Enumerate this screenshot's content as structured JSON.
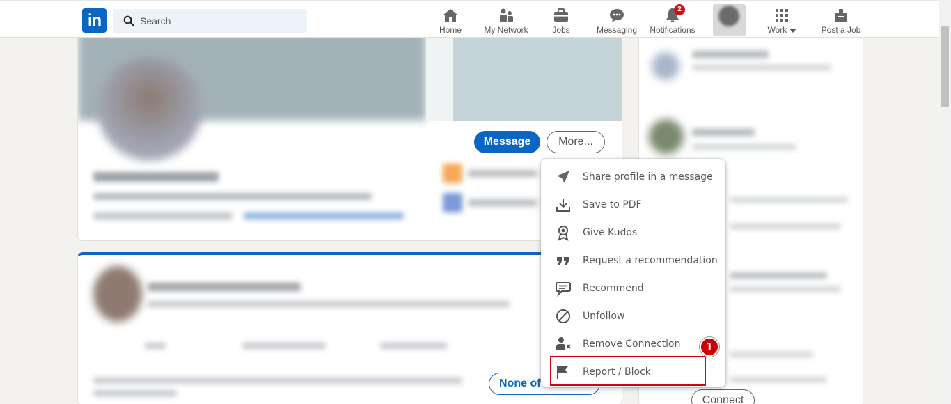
{
  "nav": {
    "search_placeholder": "Search",
    "items": [
      {
        "label": "Home",
        "icon": "home-icon"
      },
      {
        "label": "My Network",
        "icon": "network-icon"
      },
      {
        "label": "Jobs",
        "icon": "briefcase-icon"
      },
      {
        "label": "Messaging",
        "icon": "messaging-icon"
      },
      {
        "label": "Notifications",
        "icon": "bell-icon",
        "badge": "2"
      },
      {
        "label": "Work",
        "icon": "grid-icon"
      },
      {
        "label": "Post a Job",
        "icon": "post-job-icon"
      }
    ]
  },
  "profile": {
    "message_label": "Message",
    "more_label": "More..."
  },
  "activity": {
    "follow_label": "None of"
  },
  "sidebar": {
    "connect_label": "Connect"
  },
  "more_menu": {
    "items": [
      {
        "label": "Share profile in a message",
        "icon": "send-icon"
      },
      {
        "label": "Save to PDF",
        "icon": "download-icon"
      },
      {
        "label": "Give Kudos",
        "icon": "award-icon"
      },
      {
        "label": "Request a recommendation",
        "icon": "quote-icon"
      },
      {
        "label": "Recommend",
        "icon": "speech-bubble-icon"
      },
      {
        "label": "Unfollow",
        "icon": "block-icon"
      },
      {
        "label": "Remove Connection",
        "icon": "remove-person-icon"
      },
      {
        "label": "Report / Block",
        "icon": "flag-icon"
      }
    ]
  },
  "annotation": {
    "step_number": "1"
  },
  "colors": {
    "brand": "#0a66c2",
    "annotation_red": "#d0021b",
    "badge_red": "#cc1016"
  }
}
